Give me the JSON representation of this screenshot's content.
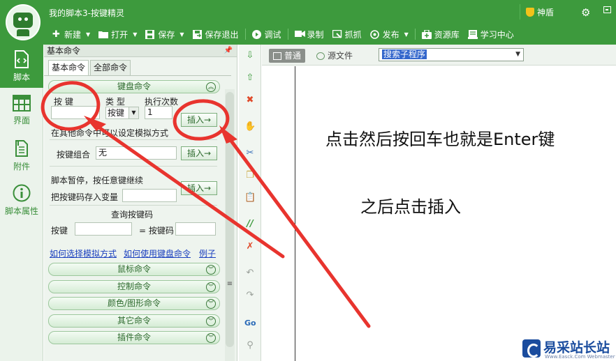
{
  "window": {
    "title": "我的脚本3-按键精灵",
    "vip_label": "神盾"
  },
  "toolbar": {
    "items": [
      {
        "label": "新建",
        "icon": "plus-icon",
        "has_menu": true
      },
      {
        "label": "打开",
        "icon": "folder-icon",
        "has_menu": true
      },
      {
        "label": "保存",
        "icon": "save-icon",
        "has_menu": true
      },
      {
        "label": "保存退出",
        "icon": "save-exit-icon",
        "has_menu": false
      },
      {
        "label": "调试",
        "icon": "play-icon",
        "has_menu": false
      },
      {
        "label": "录制",
        "icon": "camera-icon",
        "has_menu": false
      },
      {
        "label": "抓抓",
        "icon": "capture-icon",
        "has_menu": false
      },
      {
        "label": "发布",
        "icon": "publish-icon",
        "has_menu": true
      },
      {
        "label": "资源库",
        "icon": "resource-icon",
        "has_menu": false
      },
      {
        "label": "学习中心",
        "icon": "learn-icon",
        "has_menu": false
      }
    ]
  },
  "leftnav": {
    "items": [
      {
        "label": "脚本",
        "icon": "script-icon",
        "active": true
      },
      {
        "label": "界面",
        "icon": "layout-icon",
        "active": false
      },
      {
        "label": "附件",
        "icon": "attachment-icon",
        "active": false
      },
      {
        "label": "脚本属性",
        "icon": "info-icon",
        "active": false
      }
    ]
  },
  "panel": {
    "title": "基本命令",
    "tabs": [
      "基本命令",
      "全部命令"
    ],
    "keyboard": {
      "header": "键盘命令",
      "col_key": "按 键",
      "col_type": "类 型",
      "col_count": "执行次数",
      "key_value": "",
      "type_value": "按键",
      "count_value": "1",
      "insert": "插入→",
      "hint": "在其他命令中可以设定模拟方式",
      "combo_label": "按键组合",
      "combo_value": "无",
      "pause_label": "脚本暂停，按任意键继续",
      "store_label": "把按键码存入变量",
      "store_value": "",
      "query_title": "查询按键码",
      "query_key_label": "按键",
      "query_key_value": "",
      "query_code_label": "= 按键码",
      "query_code_value": ""
    },
    "links": [
      "如何选择模拟方式",
      "如何使用键盘命令",
      "例子"
    ],
    "sections": [
      "鼠标命令",
      "控制命令",
      "颜色/图形命令",
      "其它命令",
      "插件命令"
    ]
  },
  "editor": {
    "tabs": [
      "普通",
      "源文件"
    ],
    "function_select": "搜索子程序",
    "note_1": "点击然后按回车也就是Enter键",
    "note_2": "之后点击插入"
  },
  "watermark": {
    "text": "易采站长站",
    "sub": "Www.Easck.Com Webmaster"
  },
  "colors": {
    "brand_green": "#3d9a3d",
    "annotation_red": "#e8342e",
    "link_blue": "#1a3fbf"
  }
}
